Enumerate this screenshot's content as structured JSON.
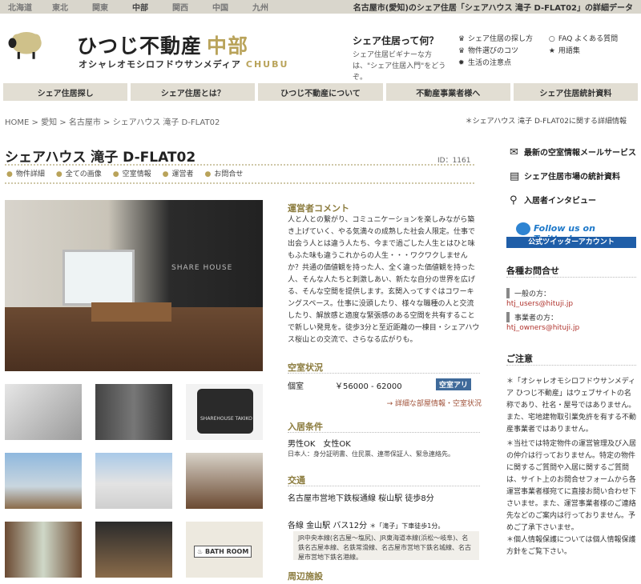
{
  "top_nav": {
    "regions": [
      "北海道",
      "東北",
      "関東",
      "中部",
      "関西",
      "中国",
      "九州"
    ],
    "active": "中部",
    "headline": "名古屋市(愛知)のシェア住居「シェアハウス 滝子 D-FLAT02」の詳細データ"
  },
  "header": {
    "brand": "ひつじ不動産",
    "region_label": "中部",
    "tagline": "オシャレオモシロフドウサンメディア",
    "region_en": "CHUBU",
    "intro_title": "シェア住居って何？",
    "intro_desc": "シェア住居ビギナーな方は、\"シェア住居入門\"をどうぞ。",
    "quick_links": [
      {
        "icon": "crown-icon",
        "label": "シェア住居の探し方"
      },
      {
        "icon": "faq-icon",
        "label": "FAQ よくある質問"
      },
      {
        "icon": "crown-icon",
        "label": "物件選びのコツ"
      },
      {
        "icon": "star-icon",
        "label": "用語集"
      },
      {
        "icon": "gear-icon",
        "label": "生活の注意点"
      }
    ]
  },
  "main_nav": [
    "シェア住居探し",
    "シェア住居とは？",
    "ひつじ不動産について",
    "不動産事業者様へ",
    "シェア住居統計資料"
  ],
  "breadcrumb": [
    "HOME",
    "愛知",
    "名古屋市",
    "シェアハウス 滝子 D-FLAT02"
  ],
  "breadcrumb_right": "＊シェアハウス 滝子 D-FLAT02に関する詳細情報",
  "property": {
    "title": "シェアハウス 滝子 D-FLAT02",
    "id": "ID：1161",
    "tabs": [
      "物件詳細",
      "全ての画像",
      "空室情報",
      "運営者",
      "お問合せ"
    ]
  },
  "photos": {
    "hero_text": "SHARE HOUSE",
    "thumb_label": "BATH ROOM",
    "sign": "SHAREHOUSE TAKIKO"
  },
  "operator_comment": {
    "title": "運営者コメント",
    "text": "人と人との繋がり、コミュニケーションを楽しみながら築き上げていく、やる気満々の成熟した社会人限定。仕事で出会う人とは違う人たち、今まで過ごした人生とはひと味もふた味も違うこれからの人生・・・ワクワクしませんか？共通の価値観を持った人、全く違った価値観を持った人、そんな人たちと刺激しあい、新たな自分の世界を広げる、そんな空間を提供します。玄関入ってすぐはコワーキングスペース。仕事に没頭したり、様々な職種の人と交流したり、解放感と適度な緊張感のある空間を共有することで新しい発見を。徒歩3分と至近距離の一棟目・シェアハウス桜山との交流で、さらなる広がりも。"
  },
  "vacancy": {
    "title": "空室状況",
    "room_type": "個室",
    "price": "￥56000 - 62000",
    "badge": "空室アリ",
    "link": "→ 詳細な部屋情報・空室状況"
  },
  "conditions": {
    "title": "入居条件",
    "gender": "男性OK　女性OK",
    "docs": "日本人：身分証明書、住民票、連帯保証人、緊急連絡先。"
  },
  "access": {
    "title": "交通",
    "line1": "名古屋市営地下鉄桜通線 桜山駅 徒歩8分",
    "line2_main": "各線 金山駅 バス12分",
    "line2_note": "＊「滝子」下車徒歩1分。",
    "box": "JR中央本線(名古屋〜塩尻)、JR東海道本線(浜松〜岐阜)、名鉄名古屋本線、名鉄常滑線、名古屋市営地下鉄名城線、名古屋市営地下鉄名港線。"
  },
  "nearby": {
    "title": "周辺施設"
  },
  "sidebar": {
    "services": [
      "最新の空室情報メールサービス",
      "シェア住居市場の統計資料",
      "入居者インタビュー"
    ],
    "twitter_follow": "Follow us on Twitter!",
    "twitter_account": "公式ツイッターアカウント",
    "contact_title": "各種お問合せ",
    "general_label": "一般の方：",
    "general_email": "htj_users@hituji.jp",
    "business_label": "事業者の方：",
    "business_email": "htj_owners@hituji.jp",
    "caution_title": "ご注意",
    "notes": [
      "＊「オシャレオモシロフドウサンメディア ひつじ不動産」はウェブサイトの名称であり、社名・屋号ではありません。また、宅地建物取引業免許を有する不動産事業者ではありません。",
      "＊当社では特定物件の運営管理及び入居の仲介は行っておりません。特定の物件に関するご質問や入居に関するご質問は、サイト上のお問合せフォームから各運営事業者様宛てに直接お問い合わせ下さいませ。また、運営事業者様のご連絡先などのご案内は行っておりません。予めご了承下さいませ。",
      "＊個人情報保護については個人情報保護方針をご覧下さい。"
    ]
  }
}
